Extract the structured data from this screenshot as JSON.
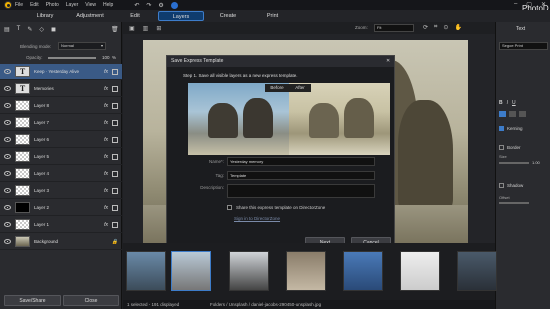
{
  "menu": [
    "File",
    "Edit",
    "Photo",
    "Layer",
    "View",
    "Help"
  ],
  "app_title": "PhotoD",
  "modes": [
    "Library",
    "Adjustment",
    "Layers",
    "Create",
    "Print"
  ],
  "active_mode": "Layers",
  "layers_panel": {
    "blending_label": "Blending mode:",
    "blending_value": "Normal",
    "opacity_label": "Opacity:",
    "opacity_value": "100",
    "opacity_unit": "%",
    "layers": [
      {
        "name": "Keep · Yesterday Alive",
        "kind": "text",
        "selected": true
      },
      {
        "name": "Memories",
        "kind": "text",
        "selected": false
      },
      {
        "name": "Layer 8",
        "kind": "image",
        "selected": false
      },
      {
        "name": "Layer 7",
        "kind": "image",
        "selected": false
      },
      {
        "name": "Layer 6",
        "kind": "image",
        "selected": false
      },
      {
        "name": "Layer 5",
        "kind": "image",
        "selected": false
      },
      {
        "name": "Layer 4",
        "kind": "image",
        "selected": false
      },
      {
        "name": "Layer 3",
        "kind": "image",
        "selected": false
      },
      {
        "name": "Layer 2",
        "kind": "black",
        "selected": false
      },
      {
        "name": "Layer 1",
        "kind": "image",
        "selected": false
      },
      {
        "name": "Background",
        "kind": "photo",
        "selected": false
      }
    ],
    "save_share": "Save/Share",
    "close": "Close"
  },
  "toolbar": {
    "zoom_label": "Zoom:",
    "zoom_value": "Fit"
  },
  "dialog": {
    "title": "Save Express Template",
    "step": "Step 1. Save all visible layers as a new express template.",
    "before": "Before",
    "after": "After",
    "name_label": "Name*:",
    "name_value": "Yesterday memory",
    "tag_label": "Tag:",
    "tag_value": "Template",
    "description_label": "Description:",
    "description_value": "",
    "share_label": "Share this express template on DirectorZone",
    "signin_link": "Sign in to DirectorZone",
    "next": "Next",
    "cancel": "Cancel"
  },
  "right_panel": {
    "tab": "Text",
    "font": "Segoe Print",
    "kerning": "Kerning",
    "border": "Border",
    "shadow": "Shadow",
    "offset": "Offset",
    "size_label": "Size",
    "size_value": "1.00"
  },
  "status": {
    "count": "1 selected - 191 displayed",
    "path": "Folders / Unsplash / daniel-jacobs-290450-unsplash.jpg"
  },
  "colors": {
    "accent": "#3d7cc9",
    "selection": "#3a5a86",
    "logo": "#f4b400"
  }
}
